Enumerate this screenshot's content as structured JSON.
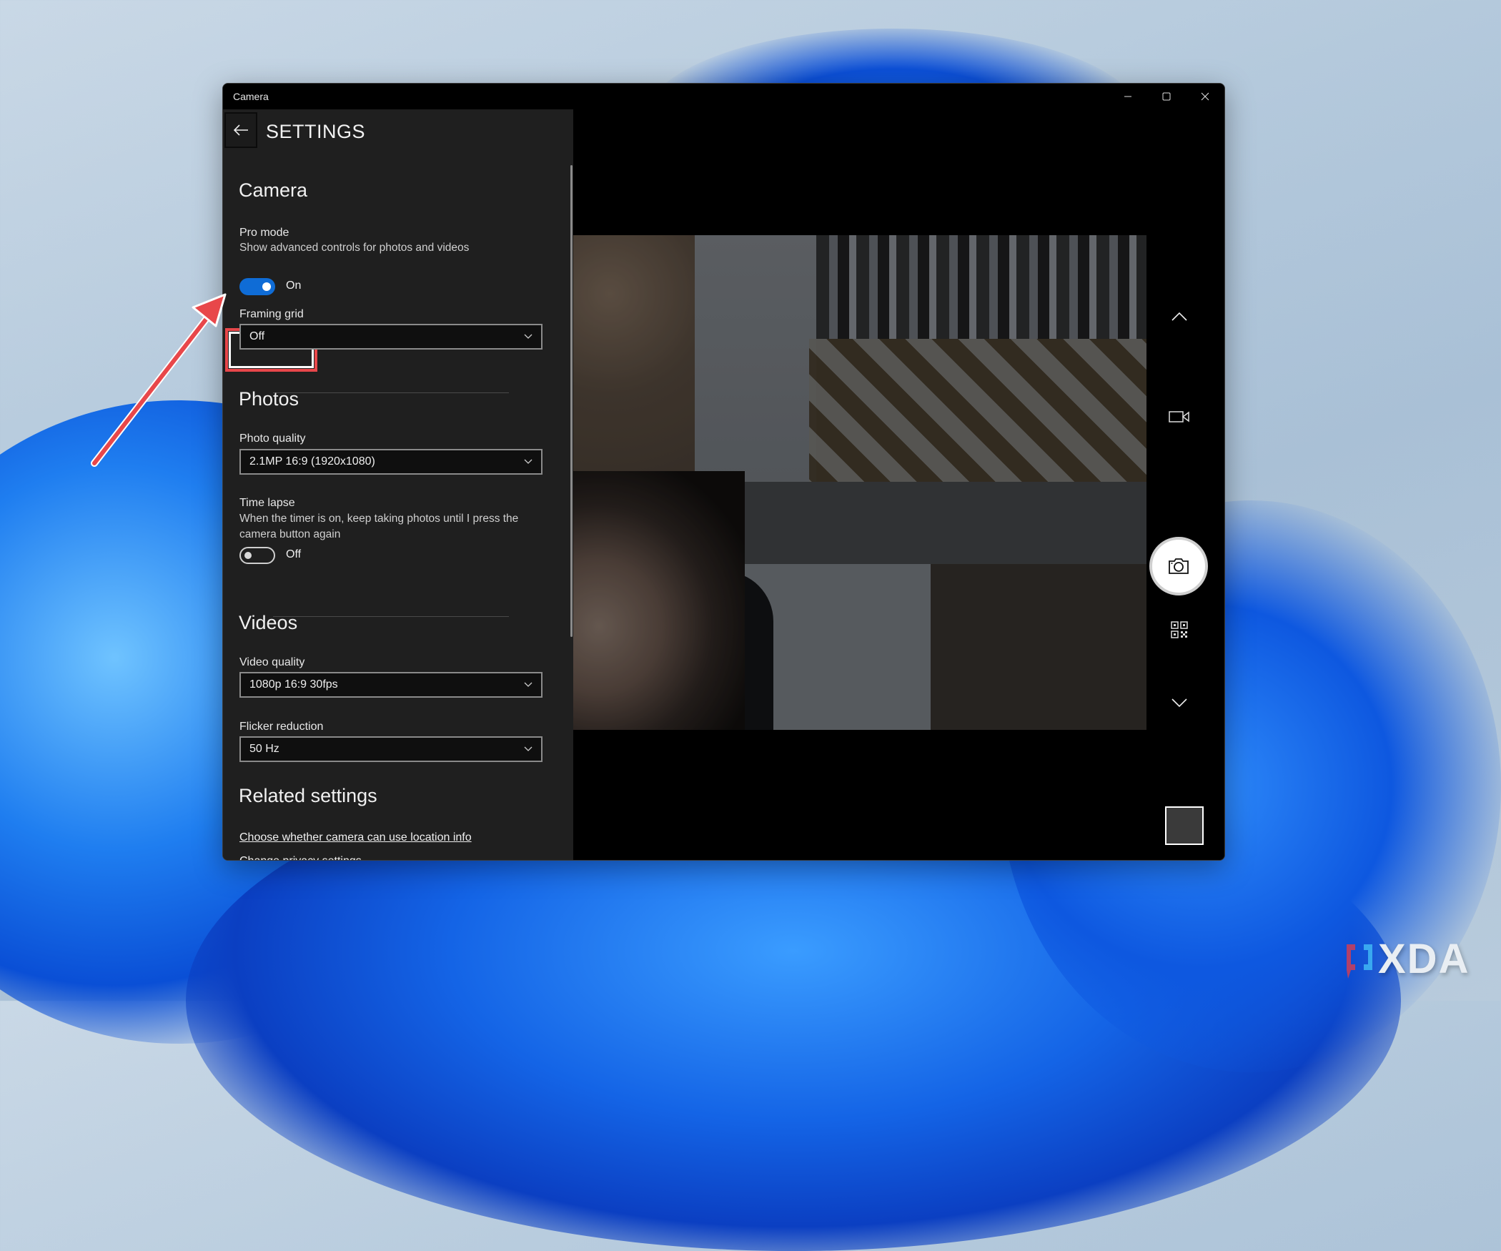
{
  "window": {
    "title": "Camera",
    "controls": {
      "minimize": "minimize",
      "maximize": "maximize",
      "close": "close"
    }
  },
  "settings": {
    "back_icon": "arrow-left-icon",
    "title": "SETTINGS",
    "camera": {
      "heading": "Camera",
      "pro_mode": {
        "label": "Pro mode",
        "description": "Show advanced controls for photos and videos",
        "state_label": "On",
        "enabled": true
      },
      "framing_grid": {
        "label": "Framing grid",
        "value": "Off"
      }
    },
    "photos": {
      "heading": "Photos",
      "photo_quality": {
        "label": "Photo quality",
        "value": "2.1MP 16:9 (1920x1080)"
      },
      "time_lapse": {
        "label": "Time lapse",
        "description": "When the timer is on, keep taking photos until I press the camera button again",
        "state_label": "Off",
        "enabled": false
      }
    },
    "videos": {
      "heading": "Videos",
      "video_quality": {
        "label": "Video quality",
        "value": "1080p 16:9 30fps"
      },
      "flicker_reduction": {
        "label": "Flicker reduction",
        "value": "50 Hz"
      }
    },
    "related": {
      "heading": "Related settings",
      "links": [
        "Choose whether camera can use location info",
        "Change privacy settings"
      ]
    }
  },
  "viewfinder": {
    "controls": [
      "chevron-up-icon",
      "video-camera-icon",
      "camera-shutter-icon",
      "qr-code-icon",
      "chevron-down-icon",
      "gallery-thumbnail"
    ]
  },
  "annotation": {
    "color": "#e8474a",
    "target": "pro-mode-toggle"
  },
  "watermark": {
    "text": "XDA"
  },
  "colors": {
    "accent": "#0f6cd6",
    "pane_bg": "#1f1f1f",
    "highlight": "#e8474a"
  }
}
